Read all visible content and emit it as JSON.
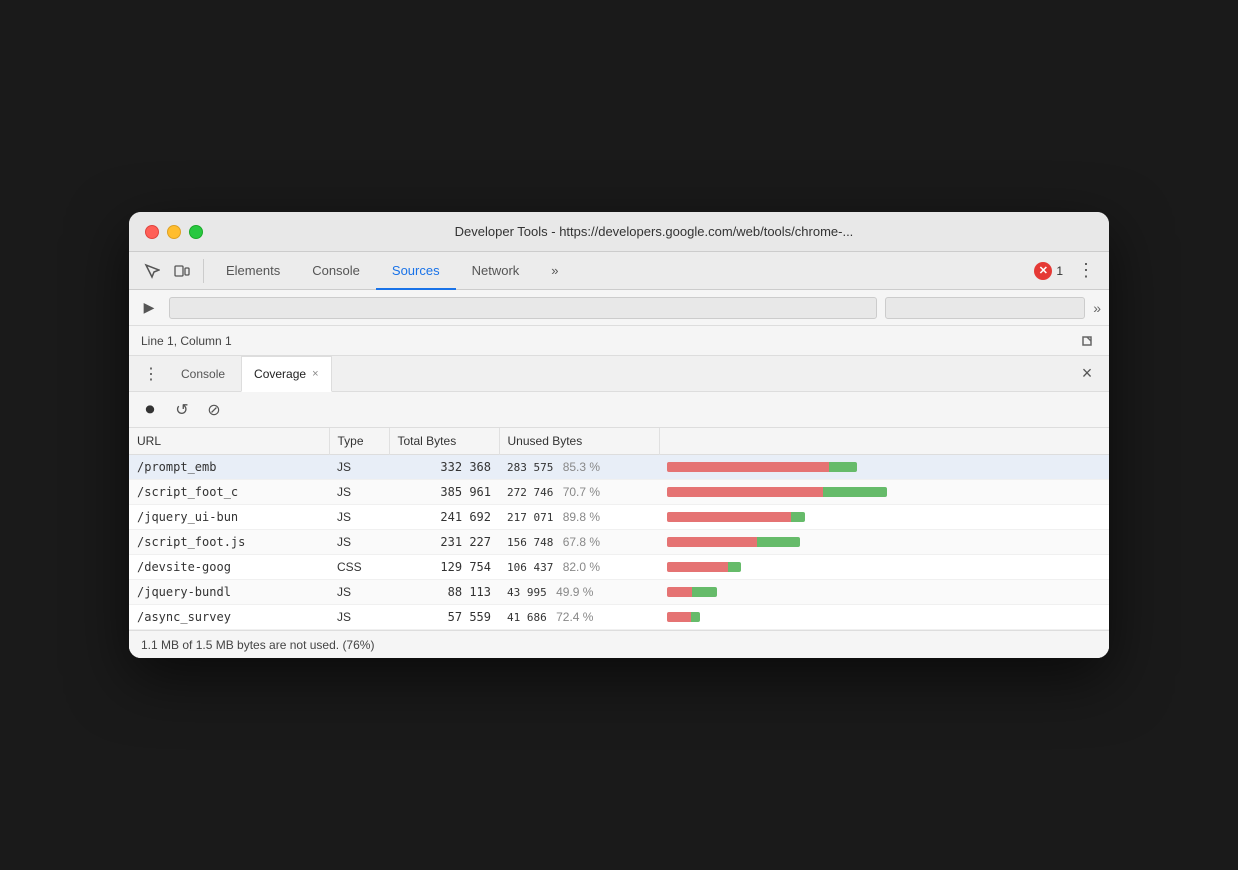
{
  "window": {
    "title": "Developer Tools - https://developers.google.com/web/tools/chrome-..."
  },
  "traffic_lights": {
    "red_label": "close",
    "yellow_label": "minimize",
    "green_label": "maximize"
  },
  "tabs": {
    "items": [
      {
        "id": "elements",
        "label": "Elements",
        "active": false
      },
      {
        "id": "console",
        "label": "Console",
        "active": false
      },
      {
        "id": "sources",
        "label": "Sources",
        "active": true
      },
      {
        "id": "network",
        "label": "Network",
        "active": false
      },
      {
        "id": "more",
        "label": "»",
        "active": false
      }
    ]
  },
  "error_badge": {
    "count": "1"
  },
  "status_bar": {
    "position": "Line 1, Column 1"
  },
  "drawer": {
    "tabs": [
      {
        "id": "console",
        "label": "Console",
        "closeable": false
      },
      {
        "id": "coverage",
        "label": "Coverage",
        "closeable": true,
        "active": true
      }
    ],
    "close_label": "×"
  },
  "coverage": {
    "toolbar": {
      "record_label": "⏺",
      "reload_label": "↺",
      "clear_label": "⊘"
    },
    "table": {
      "headers": [
        "URL",
        "Type",
        "Total Bytes",
        "Unused Bytes",
        ""
      ],
      "rows": [
        {
          "url": "/prompt_emb",
          "type": "JS",
          "total_bytes": "332 368",
          "unused_bytes": "283 575",
          "unused_pct": "85.3 %",
          "red_pct": 85.3,
          "total_pct": 100,
          "bar_scale": 1.0
        },
        {
          "url": "/script_foot_c",
          "type": "JS",
          "total_bytes": "385 961",
          "unused_bytes": "272 746",
          "unused_pct": "70.7 %",
          "red_pct": 70.7,
          "total_pct": 100,
          "bar_scale": 1.16
        },
        {
          "url": "/jquery_ui-bun",
          "type": "JS",
          "total_bytes": "241 692",
          "unused_bytes": "217 071",
          "unused_pct": "89.8 %",
          "red_pct": 89.8,
          "total_pct": 100,
          "bar_scale": 0.73
        },
        {
          "url": "/script_foot.js",
          "type": "JS",
          "total_bytes": "231 227",
          "unused_bytes": "156 748",
          "unused_pct": "67.8 %",
          "red_pct": 67.8,
          "total_pct": 100,
          "bar_scale": 0.7
        },
        {
          "url": "/devsite-goog",
          "type": "CSS",
          "total_bytes": "129 754",
          "unused_bytes": "106 437",
          "unused_pct": "82.0 %",
          "red_pct": 82.0,
          "total_pct": 100,
          "bar_scale": 0.39
        },
        {
          "url": "/jquery-bundl",
          "type": "JS",
          "total_bytes": "88 113",
          "unused_bytes": "43 995",
          "unused_pct": "49.9 %",
          "red_pct": 49.9,
          "total_pct": 100,
          "bar_scale": 0.265
        },
        {
          "url": "/async_survey",
          "type": "JS",
          "total_bytes": "57 559",
          "unused_bytes": "41 686",
          "unused_pct": "72.4 %",
          "red_pct": 72.4,
          "total_pct": 100,
          "bar_scale": 0.175
        }
      ]
    },
    "footer": "1.1 MB of 1.5 MB bytes are not used. (76%)"
  }
}
